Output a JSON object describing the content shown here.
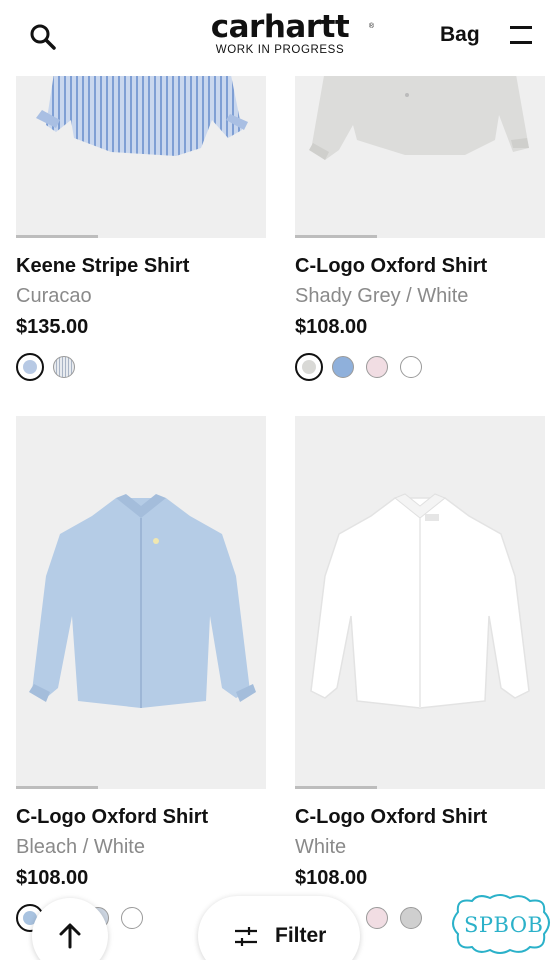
{
  "header": {
    "brand_name": "carhartt",
    "brand_tagline": "WORK IN PROGRESS",
    "bag_label": "Bag",
    "search_icon": "search-icon",
    "menu_icon": "menu-icon"
  },
  "products": [
    {
      "name": "Keene Stripe Shirt",
      "color": "Curacao",
      "price": "$135.00",
      "image": "blue-white-stripe-shirt",
      "swatches": [
        "#b7c9e4",
        "#cfd5de"
      ]
    },
    {
      "name": "C-Logo Oxford Shirt",
      "color": "Shady Grey / White",
      "price": "$108.00",
      "image": "light-grey-oxford-shirt",
      "swatches": [
        "#d9d9d6",
        "#8fb0db",
        "#f1dde3",
        "#ffffff"
      ]
    },
    {
      "name": "C-Logo Oxford Shirt",
      "color": "Bleach / White",
      "price": "$108.00",
      "image": "light-blue-oxford-shirt",
      "swatches": [
        "#a9c3e0",
        "#cdd6e2",
        "#ffffff"
      ]
    },
    {
      "name": "C-Logo Oxford Shirt",
      "color": "White",
      "price": "$108.00",
      "image": "white-oxford-shirt",
      "swatches": [
        "#f1dde3",
        "#cfcfcf"
      ]
    }
  ],
  "controls": {
    "back_to_top_icon": "arrow-up-icon",
    "filter_label": "Filter",
    "filter_icon": "sliders-icon"
  },
  "watermark": "SPBOB"
}
